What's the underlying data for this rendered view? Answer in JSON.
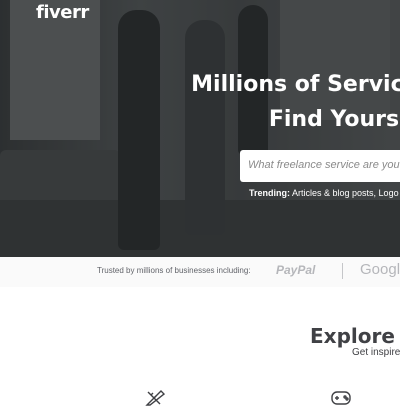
{
  "header": {
    "logo": "fiverr"
  },
  "hero": {
    "title_line1": "Millions of Services,",
    "title_line2": "Find Yours in",
    "search_placeholder": "What freelance service are you l",
    "trending_label": "Trending:",
    "trending_items": "Articles & blog posts, Logo de"
  },
  "trusted": {
    "text": "Trusted by millions of businesses including:",
    "brand1": "PayPal",
    "brand2": "Googl"
  },
  "explore": {
    "title": "Explore T",
    "subtitle": "Get inspire"
  },
  "icons": {
    "left": "pen-ruler-icon",
    "right": "gamepad-icon"
  }
}
